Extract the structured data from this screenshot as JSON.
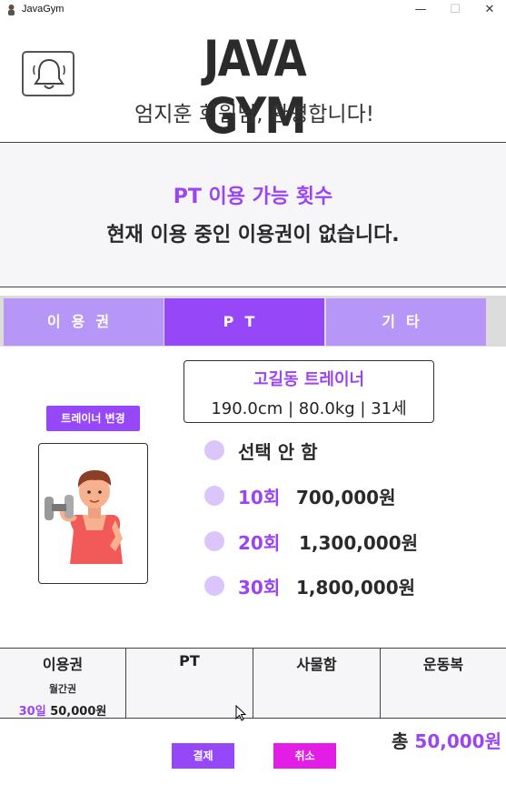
{
  "window": {
    "title": "JavaGym",
    "minimize": "—",
    "maximize": "☐",
    "close": "✕"
  },
  "header": {
    "bell_icon": "bell-icon",
    "brand": "JAVA GYM",
    "welcome": "엄지훈 회원님, 환영합니다!"
  },
  "pt_panel": {
    "title": "PT 이용 가능 횟수",
    "status": "현재 이용 중인 이용권이 없습니다."
  },
  "tabs": [
    {
      "label": "이용권",
      "active": false
    },
    {
      "label": "PT",
      "active": true
    },
    {
      "label": "기타",
      "active": false
    }
  ],
  "trainer": {
    "change_button": "트레이너 변경",
    "name": "고길동 트레이너",
    "stats": "190.0cm | 80.0kg | 31세"
  },
  "options": [
    {
      "label": "선택 안 함",
      "count": "",
      "price": ""
    },
    {
      "label": "",
      "count": "10회",
      "price": "700,000원"
    },
    {
      "label": "",
      "count": "20회",
      "price": "1,300,000원"
    },
    {
      "label": "",
      "count": "30회",
      "price": "1,800,000원"
    }
  ],
  "summary": {
    "membership": {
      "head": "이용권",
      "type": "월간권",
      "days": "30일",
      "price": "50,000원"
    },
    "pt": {
      "head": "PT"
    },
    "locker": {
      "head": "사물함"
    },
    "clothes": {
      "head": "운동복"
    }
  },
  "footer": {
    "total_label": "총",
    "total_amount": "50,000원",
    "pay": "결제",
    "cancel": "취소"
  },
  "colors": {
    "accent": "#9647f7",
    "accent_text": "#9b45f2",
    "tab_inactive": "#b696f7",
    "radio": "#dcc5fb",
    "cancel": "#e21de6"
  }
}
